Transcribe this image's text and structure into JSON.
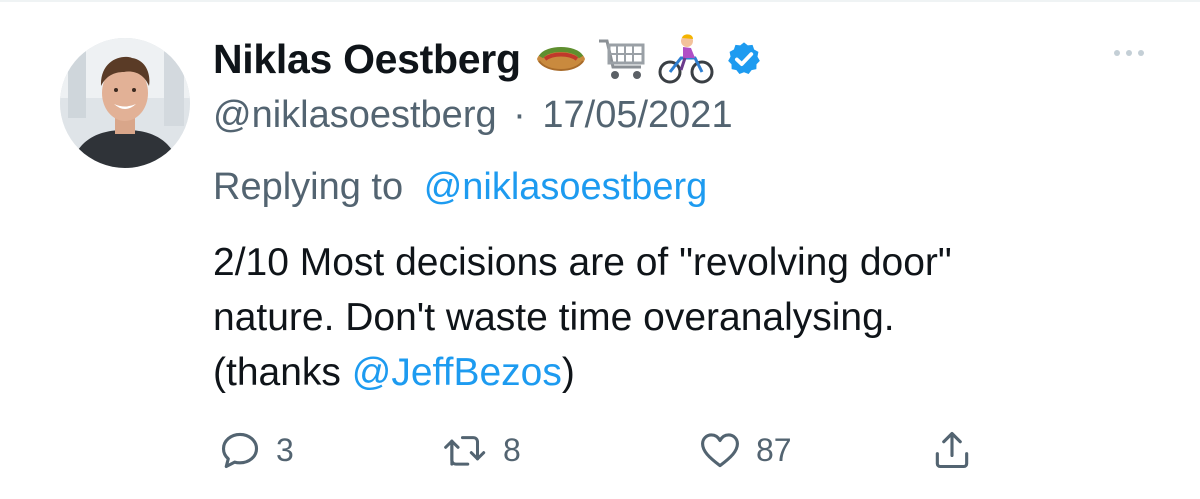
{
  "tweet": {
    "author": {
      "display_name": "Niklas Oestberg",
      "name_emojis": [
        "burrito-icon",
        "shopping-cart-icon",
        "cyclist-icon"
      ],
      "verified": true,
      "handle": "@niklasoestberg",
      "separator": "·",
      "date": "17/05/2021"
    },
    "replying_to": {
      "prefix": "Replying to",
      "handle": "@niklasoestberg"
    },
    "text": {
      "line1": "2/10 Most decisions are of \"revolving door\"",
      "line2": "nature. Don't waste time overanalysing.",
      "line3_prefix": "(thanks ",
      "line3_mention": "@JeffBezos",
      "line3_suffix": ")"
    },
    "actions": {
      "reply_count": "3",
      "retweet_count": "8",
      "like_count": "87"
    }
  },
  "colors": {
    "link": "#1d9bf0",
    "secondary_text": "#536471",
    "primary_text": "#0f1419",
    "verified_badge": "#1d9bf0"
  }
}
